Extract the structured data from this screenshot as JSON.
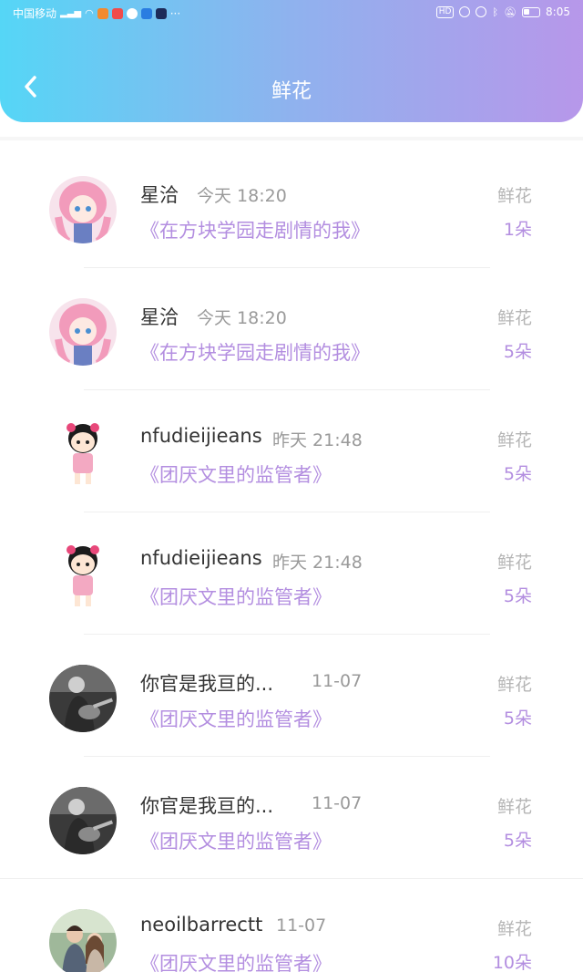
{
  "status_bar": {
    "carrier": "中国移动",
    "time": "8:05",
    "hd_badge": "HD"
  },
  "header": {
    "title": "鲜花"
  },
  "gift_label": "鲜花",
  "records": [
    {
      "user": "星洽",
      "time": "今天 18:20",
      "book": "《在方块学园走剧情的我》",
      "count": "1朵",
      "avatar": "anime-pink-hair-avatar"
    },
    {
      "user": "星洽",
      "time": "今天 18:20",
      "book": "《在方块学园走剧情的我》",
      "count": "5朵",
      "avatar": "anime-pink-hair-avatar"
    },
    {
      "user": "nfudieijieans",
      "time": "昨天 21:48",
      "book": "《团厌文里的监管者》",
      "count": "5朵",
      "avatar": "cartoon-girl-avatar"
    },
    {
      "user": "nfudieijieans",
      "time": "昨天 21:48",
      "book": "《团厌文里的监管者》",
      "count": "5朵",
      "avatar": "cartoon-girl-avatar"
    },
    {
      "user": "你官是我亘的...",
      "time": "11-07",
      "book": "《团厌文里的监管者》",
      "count": "5朵",
      "avatar": "guitar-photo-avatar"
    },
    {
      "user": "你官是我亘的...",
      "time": "11-07",
      "book": "《团厌文里的监管者》",
      "count": "5朵",
      "avatar": "guitar-photo-avatar"
    },
    {
      "user": "neoilbarrectt",
      "time": "11-07",
      "book": "《团厌文里的监管者》",
      "count": "10朵",
      "avatar": "couple-photo-avatar"
    }
  ]
}
